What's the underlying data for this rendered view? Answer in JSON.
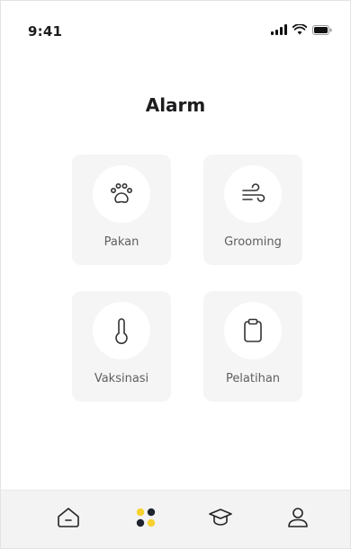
{
  "status_bar": {
    "time": "9:41"
  },
  "page": {
    "title": "Alarm"
  },
  "tiles": [
    {
      "label": "Pakan",
      "icon": "paw-icon"
    },
    {
      "label": "Grooming",
      "icon": "wind-icon"
    },
    {
      "label": "Vaksinasi",
      "icon": "thermometer-icon"
    },
    {
      "label": "Pelatihan",
      "icon": "clipboard-icon"
    }
  ],
  "bottom_nav": [
    {
      "icon": "home-icon",
      "active": false
    },
    {
      "icon": "dots-icon",
      "active": true
    },
    {
      "icon": "graduation-cap-icon",
      "active": false
    },
    {
      "icon": "profile-icon",
      "active": false
    }
  ],
  "colors": {
    "accent_yellow": "#f7d12e",
    "dark": "#1f2430",
    "tile_bg": "#f5f5f5"
  }
}
